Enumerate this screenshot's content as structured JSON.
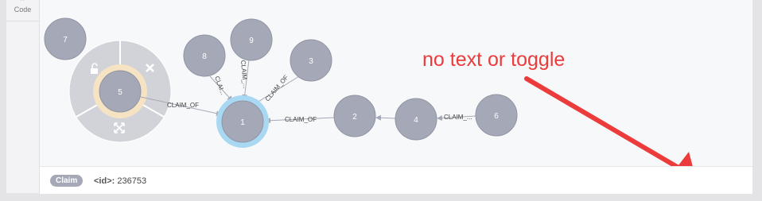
{
  "sidebar": {
    "code_label": "Code",
    "code_icon": "code-icon"
  },
  "graph": {
    "nodes": [
      {
        "id": "7",
        "label": "7"
      },
      {
        "id": "5",
        "label": "5",
        "selected": true
      },
      {
        "id": "8",
        "label": "8"
      },
      {
        "id": "9",
        "label": "9"
      },
      {
        "id": "3",
        "label": "3"
      },
      {
        "id": "1",
        "label": "1",
        "highlighted": true
      },
      {
        "id": "2",
        "label": "2"
      },
      {
        "id": "4",
        "label": "4"
      },
      {
        "id": "6",
        "label": "6"
      }
    ],
    "edges": [
      {
        "label": "CLAIM_OF"
      },
      {
        "label": "CLAI..."
      },
      {
        "label": "CLAIM_..."
      },
      {
        "label": "CLAIM_OF"
      },
      {
        "label": "CLAIM_OF"
      },
      {
        "label": "CLAIM_..."
      }
    ],
    "ring_menu": {
      "actions": [
        "unlock-icon",
        "close-icon",
        "expand-icon"
      ]
    }
  },
  "footer": {
    "badge": "Claim",
    "prop_key": "<id>:",
    "prop_value": "236753"
  },
  "annotation": {
    "text": "no text or toggle",
    "color": "#ec3b3b"
  },
  "colors": {
    "node_fill": "#a5a8b6",
    "node_stroke": "#9094a3",
    "highlight_ring": "#a9d8f3",
    "selected_ring": "#f5e3c3"
  }
}
